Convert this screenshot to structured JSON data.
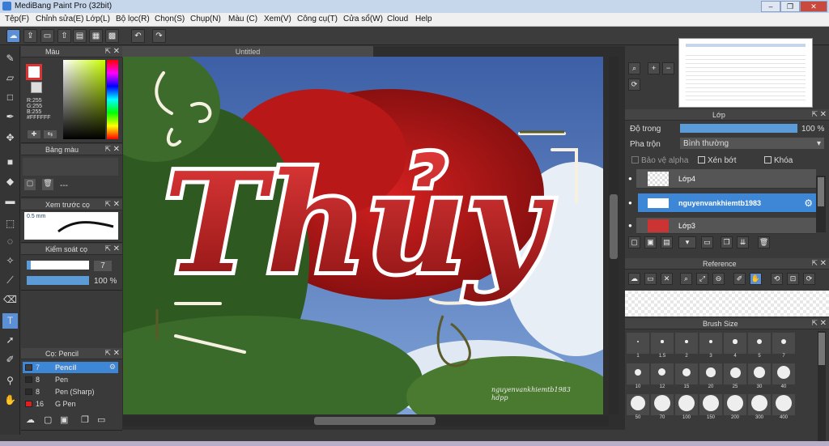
{
  "window": {
    "title": "MediBang Paint Pro (32bit)",
    "minimize": "–",
    "maximize": "❐",
    "close": "✕"
  },
  "menu": [
    "Tệp(F)",
    "Chỉnh sửa(E)",
    "Lớp(L)",
    "Bộ lọc(R)",
    "Chọn(S)",
    "Chụp(N)",
    "Màu (C)",
    "Xem(V)",
    "Công cụ(T)",
    "Cửa sổ(W)",
    "Cloud",
    "Help"
  ],
  "toolbar": {
    "undo": "↶",
    "redo": "↷"
  },
  "color_panel": {
    "title": "Màu",
    "r": "R:255",
    "g": "G:255",
    "b": "B:255",
    "hex": "#FFFFFF",
    "fg_color": "#c0392b",
    "bg_color": "#ffffff"
  },
  "palette_panel": {
    "title": "Bảng màu",
    "empty": "---"
  },
  "preview_panel": {
    "title": "Xem trước cọ",
    "size": "0.5 mm"
  },
  "brush_control": {
    "title": "Kiểm soát cọ",
    "size_value": "7",
    "opacity_value": "100 %",
    "opacity_fraction": 1.0,
    "size_fraction": 0.07
  },
  "brush_panel": {
    "title": "Cọ: Pencil",
    "items": [
      {
        "size": "7",
        "name": "Pencil",
        "color": "#3d3d3d",
        "selected": true
      },
      {
        "size": "8",
        "name": "Pen",
        "color": "#2a2a2a",
        "selected": false
      },
      {
        "size": "8",
        "name": "Pen (Sharp)",
        "color": "#2a2a2a",
        "selected": false
      },
      {
        "size": "16",
        "name": "G Pen",
        "color": "#e02020",
        "selected": false
      }
    ]
  },
  "canvas": {
    "tab": "Untitled",
    "word": "Thủy",
    "watermark_line1": "nguyenvankhiemtb1983",
    "watermark_line2": "hdpp"
  },
  "layer_panel": {
    "title": "Lớp",
    "opacity_label": "Độ trong",
    "opacity_value": "100 %",
    "opacity_fraction": 1.0,
    "blend_label": "Pha trộn",
    "blend_value": "Bình thường",
    "protect_alpha": "Bảo vệ alpha",
    "clipping": "Xén bớt",
    "lock": "Khóa",
    "layers": [
      {
        "name": "Lớp4",
        "selected": false
      },
      {
        "name": "nguyenvankhiemtb1983",
        "selected": true
      },
      {
        "name": "Lớp3",
        "selected": false
      }
    ]
  },
  "reference_panel": {
    "title": "Reference"
  },
  "brush_size_panel": {
    "title": "Brush Size",
    "sizes": [
      "1",
      "1.5",
      "2",
      "3",
      "4",
      "5",
      "7",
      "10",
      "12",
      "15",
      "20",
      "25",
      "30",
      "40",
      "50",
      "70",
      "100",
      "150",
      "200",
      "300",
      "400"
    ]
  }
}
